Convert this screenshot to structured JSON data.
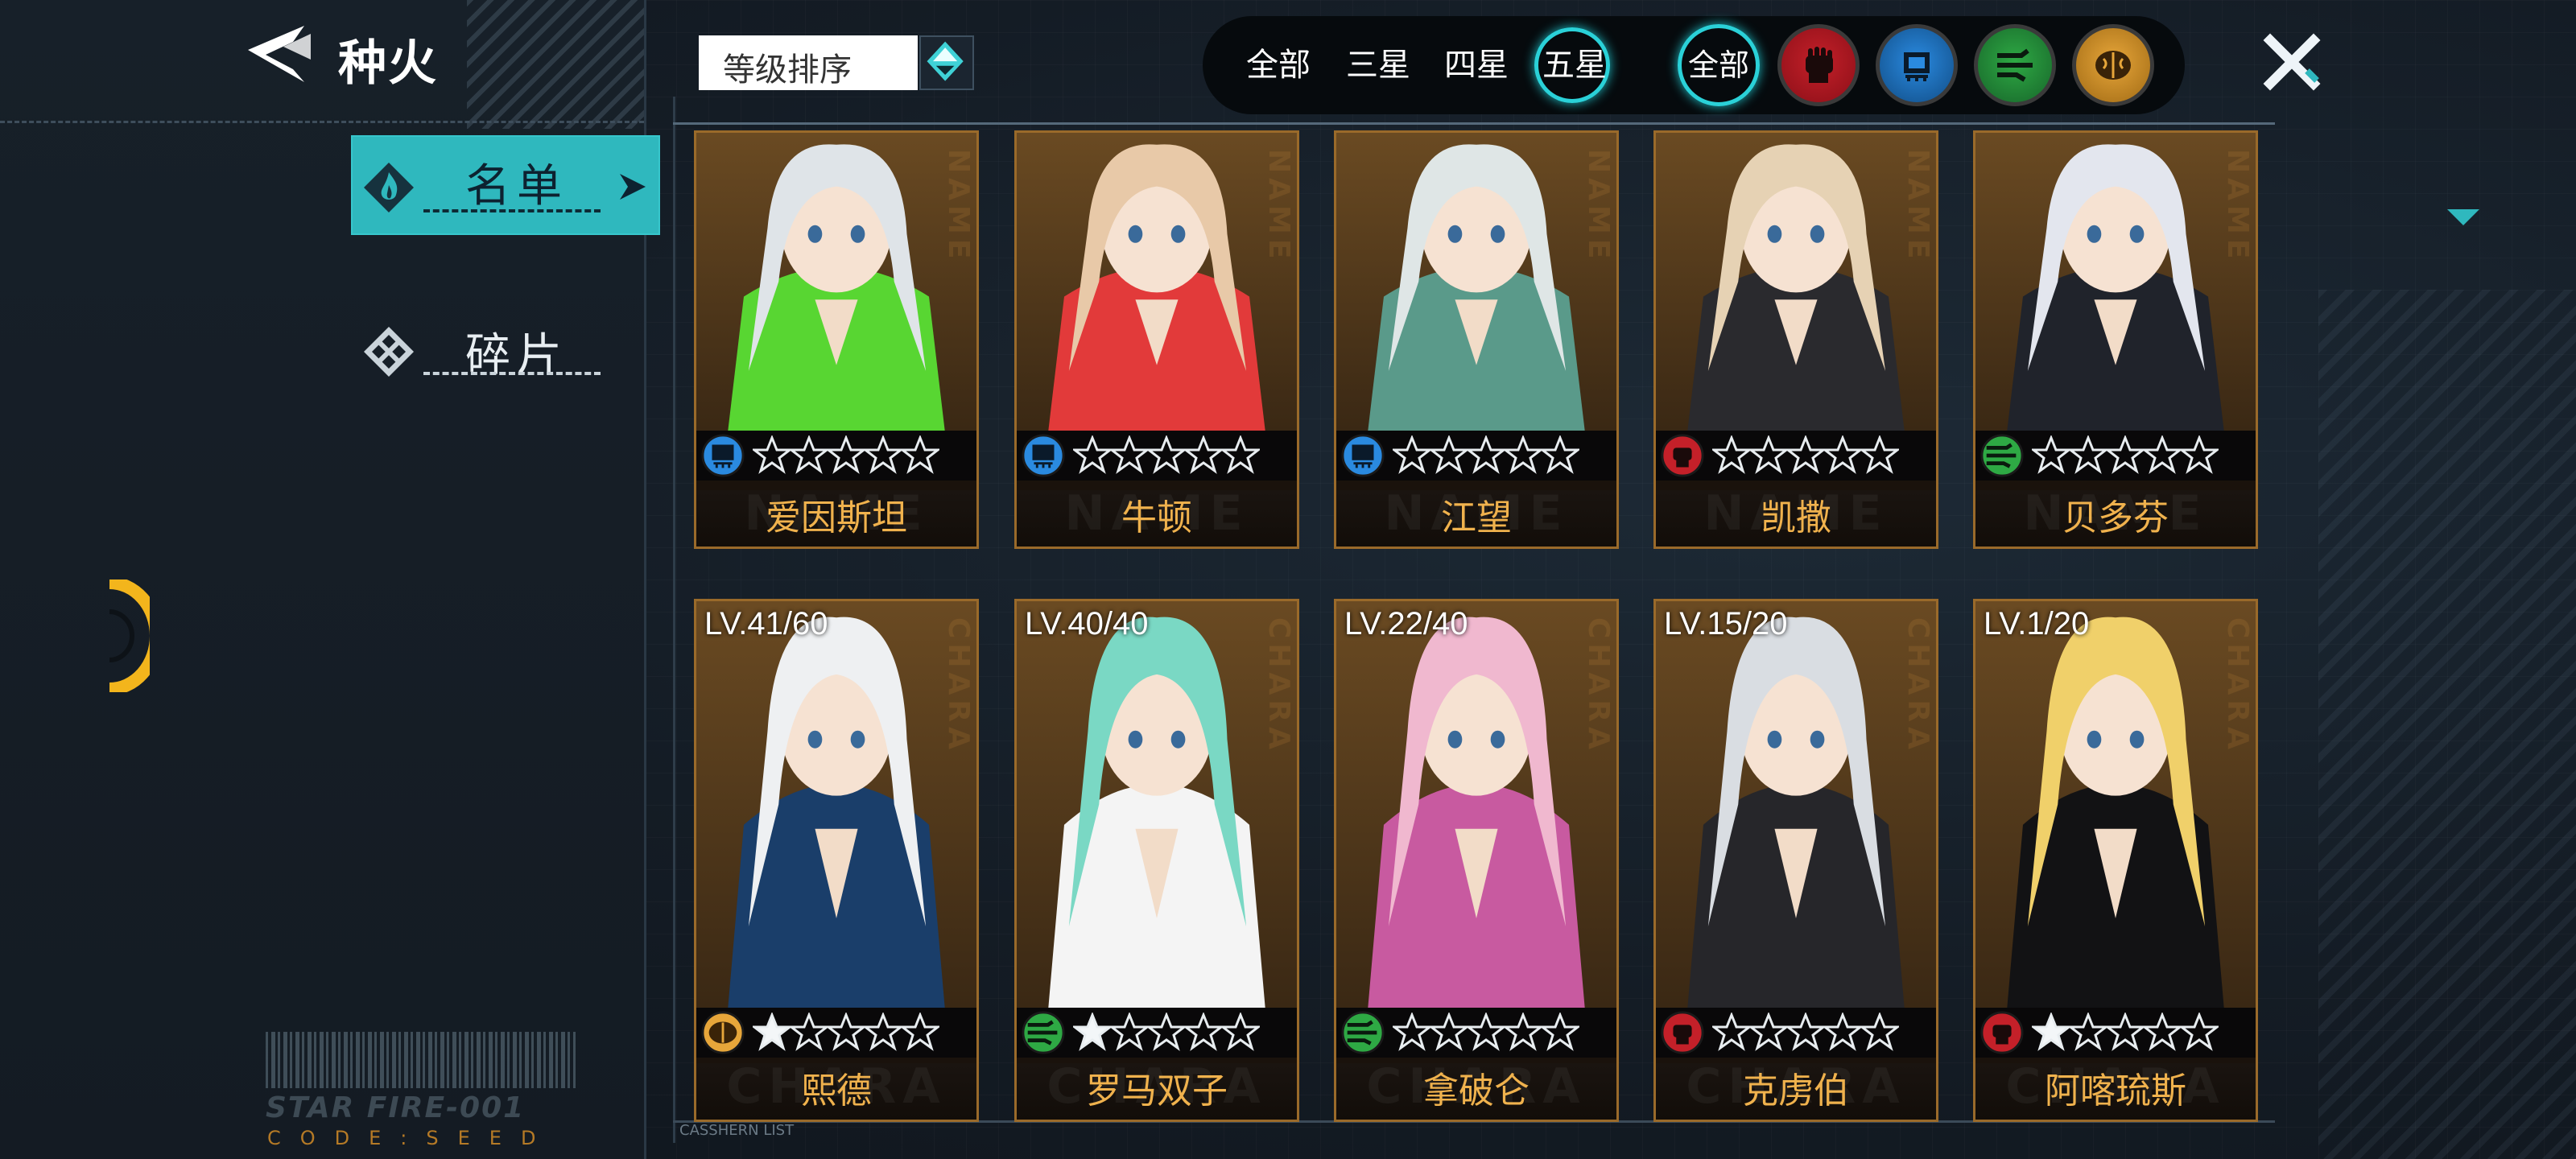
{
  "header": {
    "title": "种火"
  },
  "sidebar": {
    "tabs": [
      {
        "label": "名单",
        "active": true
      },
      {
        "label": "碎片",
        "active": false
      }
    ],
    "barcode_text": "STAR FIRE-001",
    "code_text": "CODE:SEED"
  },
  "sort": {
    "label": "等级排序"
  },
  "filters": {
    "stars": [
      "全部",
      "三星",
      "四星",
      "五星"
    ],
    "active_star": "五星",
    "class_all": "全部",
    "class_icons": [
      "fist-icon",
      "chip-icon",
      "circuit-icon",
      "brain-icon"
    ]
  },
  "roster_tag": "CASSHERN LIST",
  "colors": {
    "accent": "#2fb8be",
    "name_gold": "#f0b24d",
    "card_border": "#9a6a2a",
    "fist": "#c42029",
    "chip": "#2a8ae0",
    "circuit": "#2ea944",
    "brain": "#e7a63a"
  },
  "cards": [
    {
      "name": "爱因斯坦",
      "level": "",
      "class": "chip",
      "stars_filled": 0,
      "watermark": "NAME"
    },
    {
      "name": "牛顿",
      "level": "",
      "class": "chip",
      "stars_filled": 0,
      "watermark": "NAME"
    },
    {
      "name": "江望",
      "level": "",
      "class": "chip",
      "stars_filled": 0,
      "watermark": "NAME"
    },
    {
      "name": "凯撒",
      "level": "",
      "class": "fist",
      "stars_filled": 0,
      "watermark": "NAME"
    },
    {
      "name": "贝多芬",
      "level": "",
      "class": "circuit",
      "stars_filled": 0,
      "watermark": "NAME"
    },
    {
      "name": "熙德",
      "level": "LV.41/60",
      "class": "brain",
      "stars_filled": 1,
      "watermark": "CHARA"
    },
    {
      "name": "罗马双子",
      "level": "LV.40/40",
      "class": "circuit",
      "stars_filled": 1,
      "watermark": "CHARA"
    },
    {
      "name": "拿破仑",
      "level": "LV.22/40",
      "class": "circuit",
      "stars_filled": 0,
      "watermark": "CHARA"
    },
    {
      "name": "克虏伯",
      "level": "LV.15/20",
      "class": "fist",
      "stars_filled": 0,
      "watermark": "CHARA"
    },
    {
      "name": "阿喀琉斯",
      "level": "LV.1/20",
      "class": "fist",
      "stars_filled": 1,
      "watermark": "CHARA"
    }
  ]
}
